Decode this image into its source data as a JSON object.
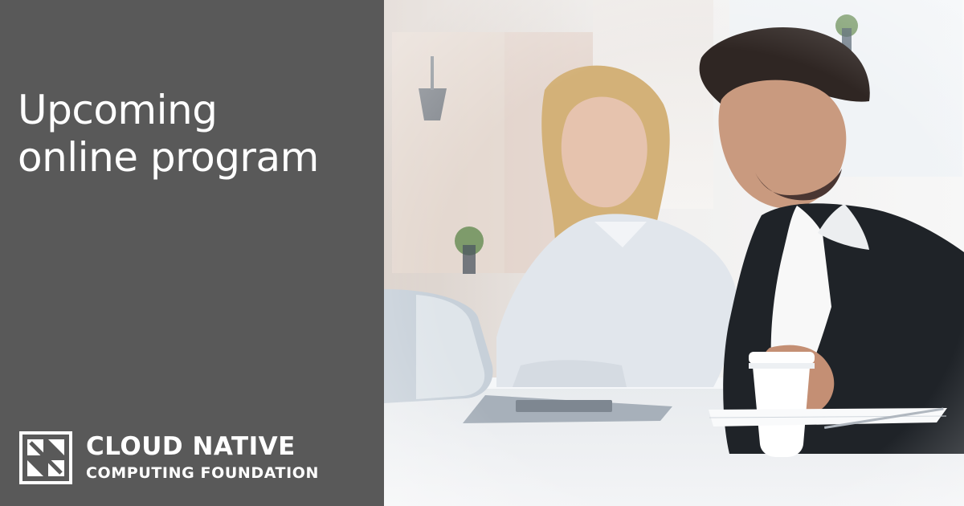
{
  "headline": {
    "line1": "Upcoming",
    "line2": "online program"
  },
  "logo": {
    "line1": "CLOUD NATIVE",
    "line2": "COMPUTING FOUNDATION",
    "icon": "cncf-logo-icon"
  },
  "colors": {
    "panel": "#595959",
    "text": "#ffffff"
  }
}
